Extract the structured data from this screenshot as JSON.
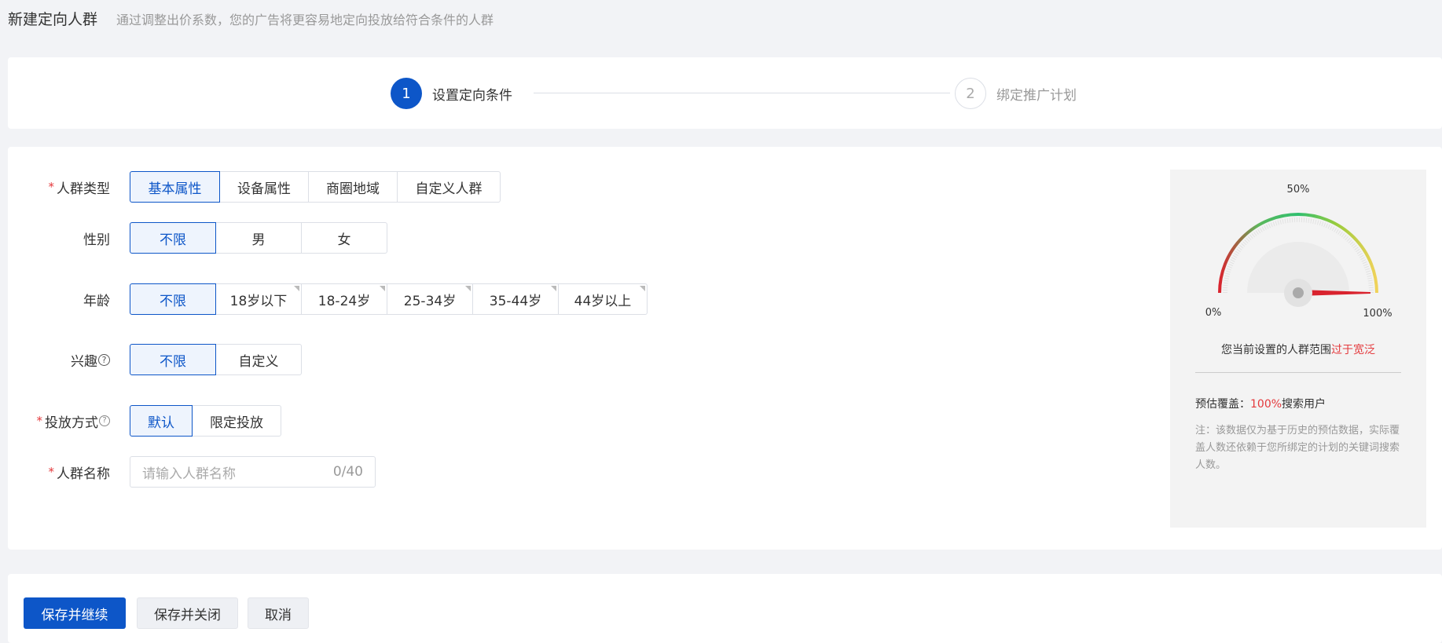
{
  "header": {
    "title": "新建定向人群",
    "description": "通过调整出价系数，您的广告将更容易地定向投放给符合条件的人群"
  },
  "steps": [
    {
      "number": "1",
      "label": "设置定向条件"
    },
    {
      "number": "2",
      "label": "绑定推广计划"
    }
  ],
  "form": {
    "crowd_type": {
      "label": "人群类型",
      "options": [
        "基本属性",
        "设备属性",
        "商圈地域",
        "自定义人群"
      ],
      "selected": "基本属性"
    },
    "gender": {
      "label": "性别",
      "options": [
        "不限",
        "男",
        "女"
      ],
      "selected": "不限"
    },
    "age": {
      "label": "年龄",
      "options": [
        "不限",
        "18岁以下",
        "18-24岁",
        "25-34岁",
        "35-44岁",
        "44岁以上"
      ],
      "selected": "不限"
    },
    "interest": {
      "label": "兴趣",
      "options": [
        "不限",
        "自定义"
      ],
      "selected": "不限"
    },
    "delivery": {
      "label": "投放方式",
      "options": [
        "默认",
        "限定投放"
      ],
      "selected": "默认"
    },
    "name": {
      "label": "人群名称",
      "placeholder": "请输入人群名称",
      "counter": "0/40"
    }
  },
  "side_panel": {
    "gauge": {
      "label_min": "0%",
      "label_mid": "50%",
      "label_max": "100%",
      "value_fraction": 1.0
    },
    "message_prefix": "您当前设置的人群范围",
    "message_warning": "过于宽泛",
    "coverage_label": "预估覆盖：",
    "coverage_value": "100%",
    "coverage_suffix": "搜索用户",
    "note": "注：该数据仅为基于历史的预估数据，实际覆盖人数还依赖于您所绑定的计划的关键词搜索人数。"
  },
  "buttons": {
    "save_continue": "保存并继续",
    "save_close": "保存并关闭",
    "cancel": "取消"
  },
  "colors": {
    "primary": "#0d56c8",
    "warning": "#e4393c"
  }
}
